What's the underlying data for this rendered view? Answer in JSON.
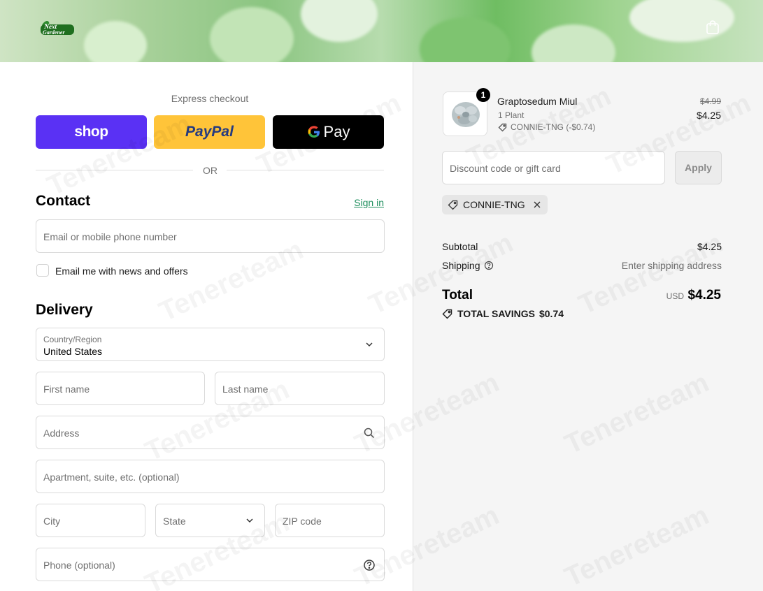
{
  "header": {
    "logo_text": "Next Gardener",
    "cart_icon": "shopping-bag-icon"
  },
  "express": {
    "label": "Express checkout",
    "buttons": [
      {
        "name": "shop",
        "label": "shop",
        "color": "#5a31f4"
      },
      {
        "name": "paypal",
        "label": "PayPal",
        "color": "#ffc439"
      },
      {
        "name": "gpay",
        "label": "Pay",
        "color": "#000000"
      }
    ],
    "or": "OR"
  },
  "contact": {
    "title": "Contact",
    "sign_in": "Sign in",
    "email_placeholder": "Email or mobile phone number",
    "newsletter_label": "Email me with news and offers"
  },
  "delivery": {
    "title": "Delivery",
    "country_label": "Country/Region",
    "country_value": "United States",
    "first_name": "First name",
    "last_name": "Last name",
    "address": "Address",
    "apartment": "Apartment, suite, etc. (optional)",
    "city": "City",
    "state": "State",
    "zip": "ZIP code",
    "phone": "Phone (optional)"
  },
  "cart": {
    "item": {
      "name": "Graptosedum Miul",
      "variant": "1 Plant",
      "discount": "CONNIE-TNG (-$0.74)",
      "price_old": "$4.99",
      "price_new": "$4.25",
      "quantity": "1"
    },
    "discount_placeholder": "Discount code or gift card",
    "apply": "Apply",
    "applied_code": "CONNIE-TNG",
    "subtotal_label": "Subtotal",
    "subtotal_value": "$4.25",
    "shipping_label": "Shipping",
    "shipping_value": "Enter shipping address",
    "total_label": "Total",
    "total_currency": "USD",
    "total_value": "$4.25",
    "savings_label": "TOTAL SAVINGS",
    "savings_value": "$0.74"
  },
  "watermark": "Tenereteam",
  "colors": {
    "accent_green": "#1f8f5e",
    "shop_purple": "#5a31f4",
    "paypal_yellow": "#ffc439"
  }
}
